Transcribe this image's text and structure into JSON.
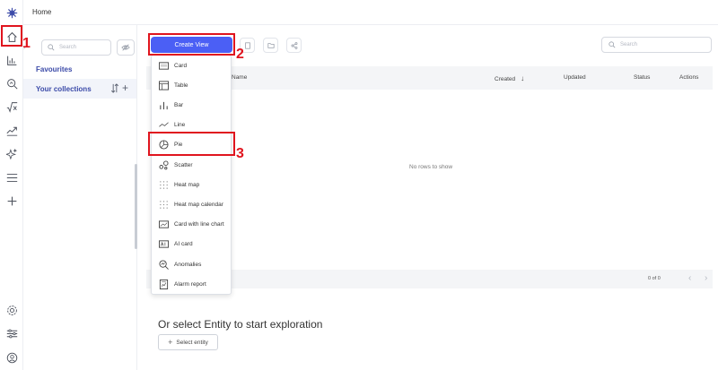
{
  "header": {
    "breadcrumb": "Home"
  },
  "rail": {
    "top_icons": [
      "home-icon",
      "bar-chart-icon",
      "search-analytics-icon",
      "sqrt-formula-icon",
      "trend-line-icon",
      "ai-sparkle-icon",
      "list-menu-icon",
      "plus-icon"
    ],
    "bottom_icons": [
      "settings-icon",
      "sliders-icon",
      "user-profile-icon"
    ]
  },
  "panel": {
    "search_placeholder": "Search",
    "favourites_label": "Favourites",
    "collections_label": "Your collections",
    "add_symbol": "+"
  },
  "main": {
    "search_placeholder": "Search",
    "create_view_label": "Create View",
    "table": {
      "columns": [
        "Name",
        "Created",
        "Updated",
        "Status",
        "Actions"
      ],
      "sort_arrow": "↓",
      "empty_text": "No rows to show",
      "pager_text": "0 of 0",
      "prev": "‹",
      "next": "›"
    },
    "explore_heading": "Or select Entity to start exploration",
    "select_entity_label": "Select entity",
    "select_entity_plus": "+"
  },
  "dropdown": {
    "items": [
      {
        "label": "Card",
        "icon": "card-icon"
      },
      {
        "label": "Table",
        "icon": "table-icon"
      },
      {
        "label": "Bar",
        "icon": "bar-icon"
      },
      {
        "label": "Line",
        "icon": "line-icon"
      },
      {
        "label": "Pie",
        "icon": "pie-icon"
      },
      {
        "label": "Scatter",
        "icon": "scatter-icon"
      },
      {
        "label": "Heat map",
        "icon": "heat-map-icon"
      },
      {
        "label": "Heat map calendar",
        "icon": "heat-map-calendar-icon"
      },
      {
        "label": "Card with line chart",
        "icon": "card-line-chart-icon"
      },
      {
        "label": "AI card",
        "icon": "ai-card-icon"
      },
      {
        "label": "Anomalies",
        "icon": "anomalies-icon"
      },
      {
        "label": "Alarm report",
        "icon": "alarm-report-icon"
      }
    ]
  },
  "annotations": {
    "step1": "1",
    "step2": "2",
    "step3": "3",
    "color": "#e0141e"
  },
  "colors": {
    "accent": "#4b5ff5",
    "collections_text": "#3b4aa8"
  }
}
